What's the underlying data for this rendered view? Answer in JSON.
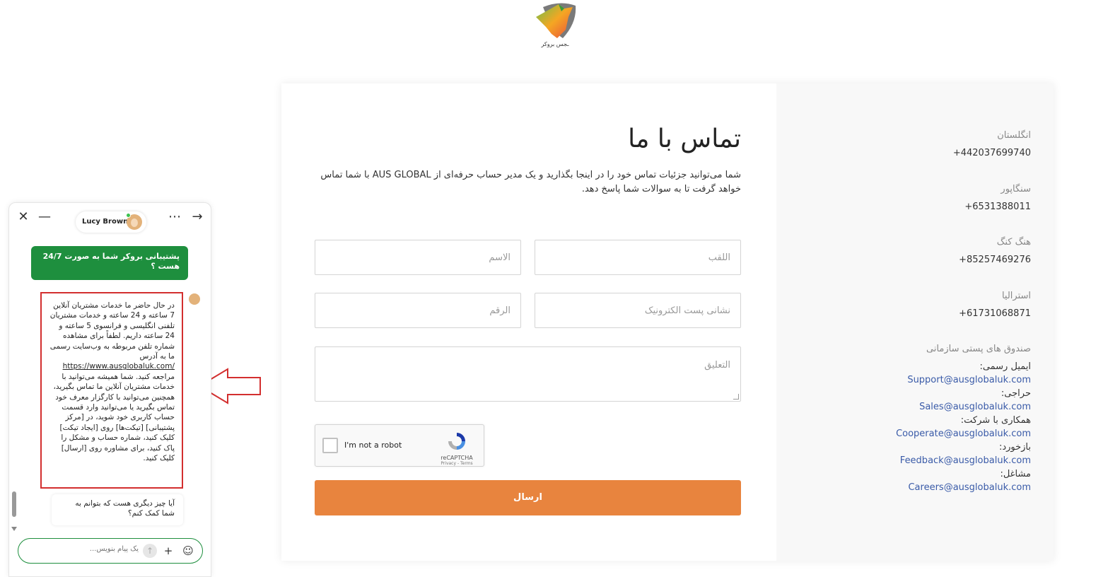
{
  "logo": {
    "text": "ـجس بروکر"
  },
  "contact": {
    "title": "تماس با ما",
    "intro": "شما می‌توانید جزئیات تماس خود را در اینجا بگذارید و یک مدیر حساب حرفه‌ای از AUS GLOBAL با شما تماس خواهد گرفت تا به سوالات شما پاسخ دهد.",
    "fields": {
      "lastname_placeholder": "اللقب",
      "name_placeholder": "الاسم",
      "email_placeholder": "نشانی پست الکترونیک",
      "phone_placeholder": "الرقم",
      "comment_placeholder": "التعليق"
    },
    "captcha": {
      "label": "I'm not a robot",
      "brand": "reCAPTCHA",
      "links": "Privacy - Terms"
    },
    "submit_label": "ارسال"
  },
  "offices": [
    {
      "country": "انگلستان",
      "phone": "+442037699740"
    },
    {
      "country": "سنگاپور",
      "phone": "+6531388011"
    },
    {
      "country": "هنگ کنگ",
      "phone": "+85257469276"
    },
    {
      "country": "استرالیا",
      "phone": "+61731068871"
    }
  ],
  "mailboxes": {
    "heading": "صندوق های پستی سازمانی",
    "items": [
      {
        "label": "ایمیل رسمی:",
        "email": "Support@ausglobaluk.com"
      },
      {
        "label": "حراجی:",
        "email": "Sales@ausglobaluk.com"
      },
      {
        "label": "همکاری با شرکت:",
        "email": "Cooperate@ausglobaluk.com"
      },
      {
        "label": "بازخورد:",
        "email": "Feedback@ausglobaluk.com"
      },
      {
        "label": "مشاغل:",
        "email": "Careers@ausglobaluk.com"
      }
    ]
  },
  "chat": {
    "agent_name": "Lucy Brown",
    "user_message": "پشتیبانی بروکر شما به صورت 24/7 هست ؟",
    "bot_message_1": "در حال حاضر ما خدمات مشتریان آنلاین 7 ساعته و 24 ساعته و خدمات مشتریان تلفنی انگلیسی و فرانسوی 5 ساعته و 24 ساعته داریم. لطفاً برای مشاهده شماره تلفن مربوطه به وب‌سایت رسمی ما به آدرس",
    "bot_link": "https://www.ausglobaluk.com/",
    "bot_message_2": "مراجعه کنید. شما همیشه می‌توانید با خدمات مشتریان آنلاین ما تماس بگیرید، همچنین می‌توانید با کارگزار معرف خود تماس بگیرید یا می‌توانید وارد قسمت حساب کاربری خود شوید، در [مرکز پشتیبانی] [تیکت‌ها] روی [ایجاد تیکت] کلیک کنید، شماره حساب و مشکل را پاک کنید، برای مشاوره روی [ارسال] کلیک کنید.",
    "bot_followup": "آیا چیز دیگری هست که بتوانم به شما کمک کنم؟",
    "input_placeholder": "یک پیام بنویس..."
  }
}
